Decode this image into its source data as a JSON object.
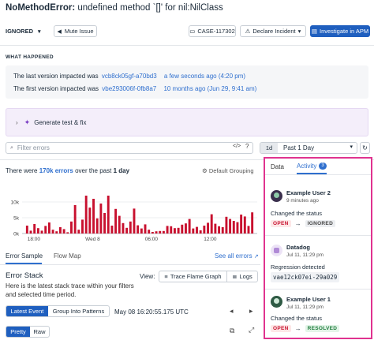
{
  "header": {
    "title_prefix": "NoMethodError:",
    "title_rest": "undefined method `[]' for nil:NilClass",
    "status_value": "IGNORED",
    "mute_label": "Mute Issue",
    "case_label": "CASE-117302",
    "declare_label": "Declare Incident",
    "investigate_label": "Investigate in APM"
  },
  "what_happened": {
    "heading": "WHAT HAPPENED",
    "last_label": "The last version impacted was",
    "last_version": "vcb8ck05gf-a70bd3",
    "last_time": "a few seconds ago (4:20 pm)",
    "first_label": "The first version impacted was",
    "first_version": "vbe293006f-0fb8a7",
    "first_time": "10 months ago (Jun 29, 9:41 am)"
  },
  "generate": {
    "label": "Generate test & fix"
  },
  "filter": {
    "placeholder": "Filter errors",
    "range_short": "1d",
    "range_label": "Past 1 Day"
  },
  "summary": {
    "prefix": "There were",
    "count": "170k errors",
    "middle": "over the past",
    "period": "1 day",
    "grouping": "Default Grouping"
  },
  "chart_data": {
    "type": "bar",
    "yticks": [
      "10k",
      "5k",
      "0k"
    ],
    "ylim": [
      0,
      14000
    ],
    "xticks": [
      "18:00",
      "Wed 8",
      "06:00",
      "12:00"
    ],
    "values": [
      2500,
      900,
      3000,
      1700,
      900,
      2400,
      3500,
      1200,
      700,
      2000,
      1400,
      400,
      3800,
      9000,
      1200,
      4400,
      12000,
      8200,
      11000,
      4800,
      9500,
      6500,
      12000,
      2500,
      7800,
      5600,
      3300,
      1800,
      3800,
      7900,
      2600,
      1600,
      2900,
      1200,
      500,
      700,
      800,
      800,
      2400,
      2300,
      1700,
      1800,
      2800,
      3200,
      4600,
      1600,
      2100,
      1000,
      2500,
      3400,
      6100,
      3100,
      2300,
      2000,
      5300,
      4600,
      4000,
      3600,
      6000,
      5400,
      2400,
      6700
    ],
    "bar_color": "#c8102e"
  },
  "tabs": {
    "error_sample": "Error Sample",
    "flow_map": "Flow Map",
    "see_all": "See all errors"
  },
  "stack": {
    "title": "Error Stack",
    "desc": "Here is the latest stack trace within your filters and selected time period.",
    "view_label": "View:",
    "flame_label": "Trace Flame Graph",
    "logs_label": "Logs",
    "latest_label": "Latest Event",
    "group_label": "Group Into Patterns",
    "timestamp": "May 08 16:20:55.175 UTC",
    "pretty_label": "Pretty",
    "raw_label": "Raw"
  },
  "panel": {
    "tab_data": "Data",
    "tab_activity": "Activity",
    "activity_count": "3",
    "items": [
      {
        "user": "Example User 2",
        "time": "9 minutes ago",
        "text": "Changed the status",
        "from": "OPEN",
        "to": "IGNORED"
      },
      {
        "user": "Datadog",
        "time": "Jul 11, 11:29 pm",
        "text": "Regression detected",
        "version": "vae12ck07ei-29a029"
      },
      {
        "user": "Example User 1",
        "time": "Jul 11, 11:29 pm",
        "text": "Changed the status",
        "from": "OPEN",
        "to": "RESOLVED"
      }
    ]
  },
  "colors": {
    "accent": "#2f6fce",
    "primary": "#1f5fbf",
    "highlight": "#e0338f",
    "bar": "#c8102e"
  }
}
